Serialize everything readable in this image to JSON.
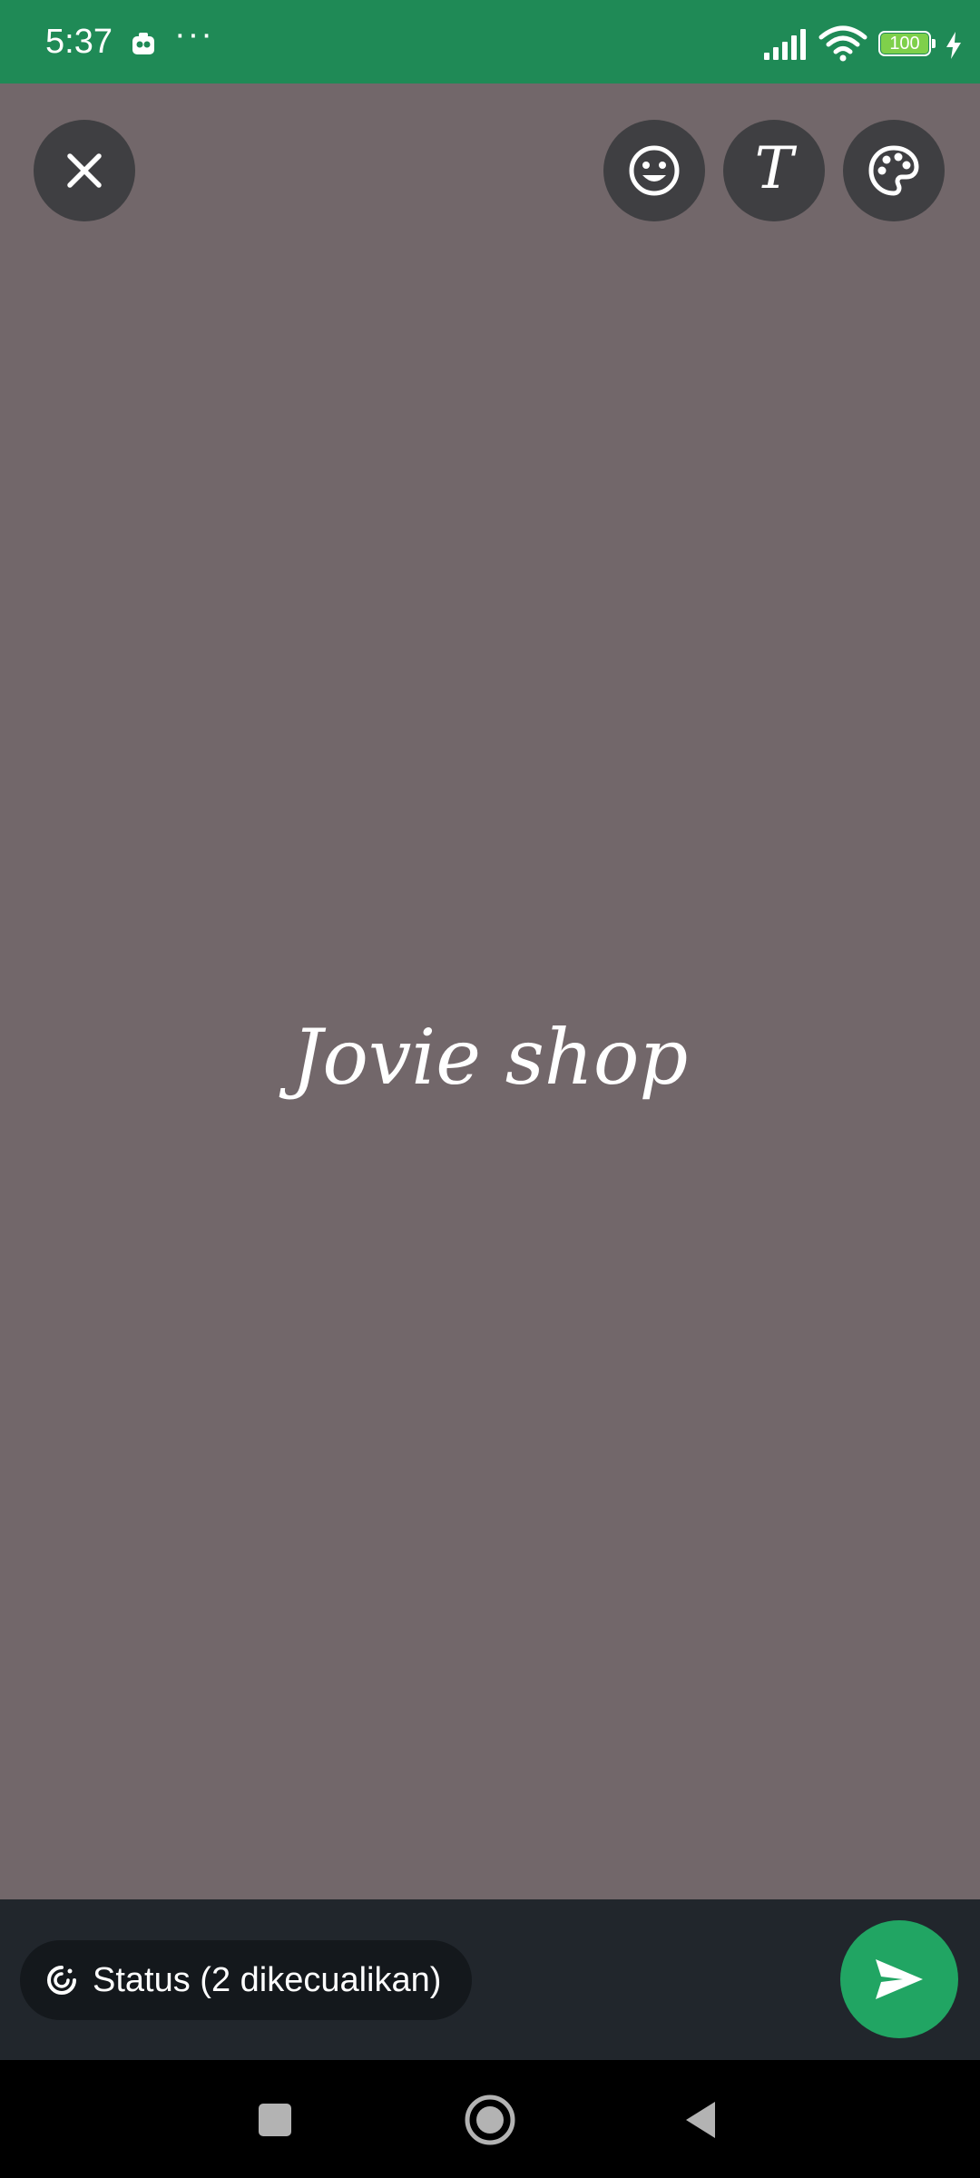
{
  "status_bar": {
    "time": "5:37",
    "more": "···",
    "battery": "100",
    "color": "#1f8a56"
  },
  "toolbar": {
    "close_icon": "close-icon",
    "emoji_icon": "emoji-icon",
    "text_glyph": "T",
    "palette_icon": "palette-icon"
  },
  "canvas": {
    "background": "#72676a",
    "text": "Jovie shop"
  },
  "footer": {
    "audience_label": "Status (2 dikecualikan)",
    "send_icon": "send-icon",
    "send_color": "#21a563"
  },
  "nav": {
    "recents_icon": "square-icon",
    "home_icon": "circle-icon",
    "back_icon": "triangle-icon"
  }
}
